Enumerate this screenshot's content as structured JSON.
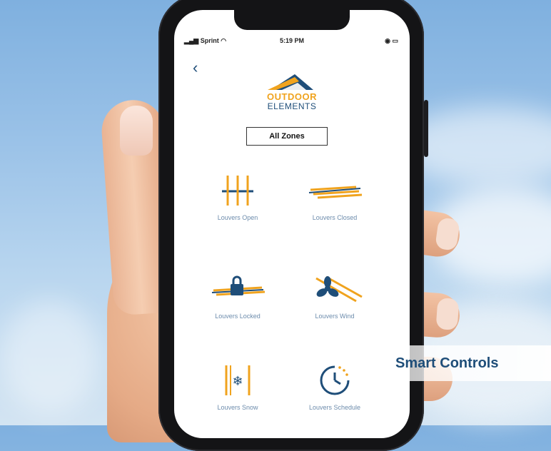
{
  "colors": {
    "accent": "#f0a31e",
    "brand": "#1f4e79",
    "label": "#6d8cac"
  },
  "status_bar": {
    "carrier": "Sprint",
    "time": "5:19 PM"
  },
  "logo": {
    "line1": "OUTDOOR",
    "line2": "ELEMENTS"
  },
  "zone_selector": {
    "label": "All Zones"
  },
  "controls": [
    {
      "label": "Louvers Open",
      "icon": "louvers-open-icon"
    },
    {
      "label": "Louvers Closed",
      "icon": "louvers-closed-icon"
    },
    {
      "label": "Louvers Locked",
      "icon": "louvers-locked-icon"
    },
    {
      "label": "Louvers Wind",
      "icon": "louvers-wind-icon"
    },
    {
      "label": "Louvers Snow",
      "icon": "louvers-snow-icon"
    },
    {
      "label": "Louvers Schedule",
      "icon": "louvers-schedule-icon"
    }
  ],
  "banner": {
    "title": "Smart Controls"
  }
}
